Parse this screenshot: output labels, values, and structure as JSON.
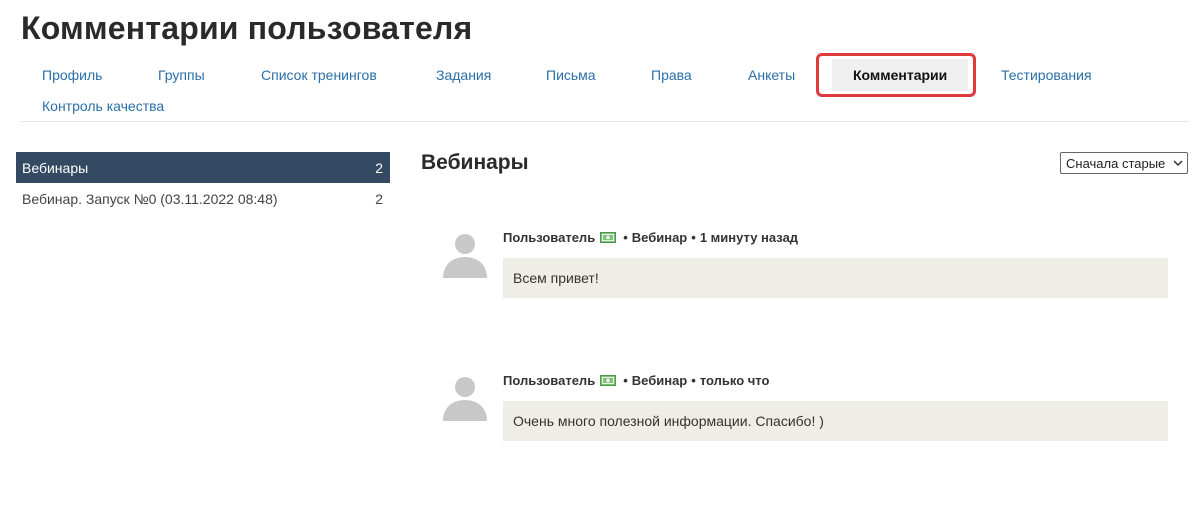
{
  "page_title": "Комментарии пользователя",
  "tabs": [
    {
      "label": "Профиль"
    },
    {
      "label": "Группы"
    },
    {
      "label": "Список тренингов"
    },
    {
      "label": "Задания"
    },
    {
      "label": "Письма"
    },
    {
      "label": "Права"
    },
    {
      "label": "Анкеты"
    },
    {
      "label": "Комментарии",
      "active": true
    },
    {
      "label": "Тестирования"
    },
    {
      "label": "Контроль качества"
    }
  ],
  "sidebar": {
    "items": [
      {
        "label": "Вебинары",
        "count": "2",
        "active": true
      },
      {
        "label": "Вебинар. Запуск №0 (03.11.2022 08:48)",
        "count": "2"
      }
    ]
  },
  "main": {
    "title": "Вебинары",
    "sort": {
      "selected": "Сначала старые"
    },
    "comments": [
      {
        "author": "Пользователь",
        "source": "Вебинар",
        "time": "1 минуту назад",
        "text": "Всем привет!"
      },
      {
        "author": "Пользователь",
        "source": "Вебинар",
        "time": "только что",
        "text": "Очень много полезной информации. Спасибо! )"
      }
    ]
  },
  "colors": {
    "accent_link": "#2a6fa8",
    "sidebar_active_bg": "#344a62",
    "highlight": "#e0393e",
    "comment_bg": "#efeee6"
  },
  "icons": {
    "avatar": "user-avatar-icon",
    "money": "money-icon",
    "chevron": "chevron-down-icon"
  }
}
